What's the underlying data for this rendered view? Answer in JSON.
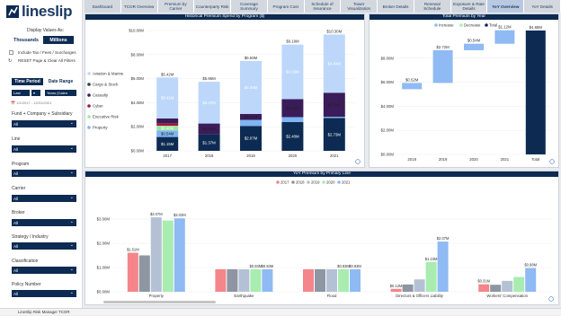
{
  "brand": {
    "name": "lineslip"
  },
  "sidebar": {
    "display_label": "Display Values As:",
    "thousands": "Thousands",
    "millions": "Millions",
    "include_tax": "Include Tax / Fees / Surcharges",
    "reset": "RESET Page & Clear All Filters",
    "time_period": "Time Period",
    "date_range": "Date Range",
    "period_value": "Last",
    "period_unit": "Years (Calen",
    "date_range_value": "1/1/2017 - 12/31/2021",
    "filters": [
      {
        "label": "Fund + Company + Subsidiary",
        "value": "All"
      },
      {
        "label": "Line",
        "value": "All"
      },
      {
        "label": "Program",
        "value": "All"
      },
      {
        "label": "Carrier",
        "value": "All"
      },
      {
        "label": "Broker",
        "value": "All"
      },
      {
        "label": "Strategy / Industry",
        "value": "All"
      },
      {
        "label": "Classification",
        "value": "All"
      },
      {
        "label": "Policy Number",
        "value": "All"
      }
    ],
    "accent": "#0d2b52"
  },
  "tabs": [
    "Dashboard",
    "TCOR Overview",
    "Premium by Carrier",
    "Counterparty Risk",
    "Coverage Summary",
    "Program Cost",
    "Schedule of Insurance",
    "Tower Visualization",
    "Broker Details",
    "Renewal Schedule",
    "Exposure & Rate Details",
    "YoY Overview",
    "YoY Details"
  ],
  "active_tab": "YoY Overview",
  "status_bar": "LineSlip Risk Manager TCOR",
  "chart_data": [
    {
      "type": "bar",
      "title": "Historical Premium Spend by Program ($)",
      "categories": [
        "2017",
        "2018",
        "2019",
        "2020",
        "2021"
      ],
      "ylim": [
        0,
        10
      ],
      "yticks": [
        "$0.00M",
        "$2.00M",
        "$4.00M",
        "$6.00M",
        "$8.00M",
        "$10.00M"
      ],
      "legend": [
        "Aviation & Marine",
        "Cargo & Stock",
        "Casualty",
        "Cyber",
        "Executive Risk",
        "Property"
      ],
      "colors": [
        "#bdd7fb",
        "#2d3e50",
        "#3a1c5a",
        "#a8123e",
        "#9ee6a0",
        "#7fb4f5",
        "#0d2b52"
      ],
      "totals": [
        "$5.42M",
        "$5.96M",
        "$6.59M",
        "$9.19M",
        "$10.30M"
      ],
      "series": [
        {
          "values": [
            1.15,
            1.37,
            2.07,
            2.4,
            2.73
          ],
          "labels": [
            "$1.15M",
            "$1.37M",
            "$2.07M",
            "$2.40M",
            "$2.73M"
          ]
        },
        {
          "values": [
            0.54,
            0.0,
            0.5,
            0.4,
            0.1
          ],
          "labels": [
            "$0.54M",
            "",
            "",
            "",
            ""
          ]
        },
        {
          "values": [
            0.4,
            0.0,
            0.0,
            0.0,
            0.0
          ],
          "labels": [
            "$0.40M",
            "",
            "",
            "",
            ""
          ]
        },
        {
          "values": [
            0.2,
            0.0,
            0.0,
            0.0,
            0.0
          ],
          "labels": [
            "",
            "",
            "",
            "",
            ""
          ]
        },
        {
          "values": [
            0.4,
            0.9,
            0.5,
            1.5,
            2.0
          ],
          "labels": [
            "",
            "$0.90M",
            "$0.50M",
            "$1.50M",
            "$2.00M"
          ]
        },
        {
          "values": [
            3.41,
            3.47,
            4.4,
            4.53,
            4.84
          ],
          "labels": [
            "$3.41M",
            "$3.47M",
            "$4.40M",
            "$4.53M",
            "$4.84M"
          ]
        }
      ]
    },
    {
      "type": "bar",
      "title": "Total Premium by Year",
      "legend": [
        "Increase",
        "Decrease",
        "Total"
      ],
      "colors": [
        "#8fbaf3",
        "#a8ecb0",
        "#0d2b52"
      ],
      "categories": [
        "2018",
        "2019",
        "2020",
        "2021",
        "Total"
      ],
      "ylim": [
        0,
        10
      ],
      "yticks": [
        "$0.00M",
        "$2.00M",
        "$4.00M",
        "$6.00M",
        "$8.00M"
      ],
      "values": [
        0.52,
        2.72,
        0.54,
        1.12,
        4.88
      ],
      "labels": [
        "$0.52M",
        "$2.72M",
        "$0.54M",
        "$1.12M",
        "$4.88M"
      ],
      "kind": [
        "increase",
        "increase",
        "increase",
        "increase",
        "total"
      ]
    },
    {
      "type": "bar",
      "title": "YoY Premium by Primary Line",
      "legend": [
        "2017",
        "2018",
        "2019",
        "2020",
        "2021"
      ],
      "colors": [
        "#f4858a",
        "#8d96a2",
        "#b4c1d5",
        "#a8ecb0",
        "#8fbaf3"
      ],
      "categories": [
        "Property",
        "Earthquake",
        "Flood",
        "Directors & Officers Liability",
        "Workers' Compensation"
      ],
      "ylim": [
        0,
        4
      ],
      "yticks": [
        "$0.00M",
        "$1.00M",
        "$2.00M",
        "$3.00M"
      ],
      "series": [
        {
          "name": "2017",
          "values": [
            1.61,
            0.93,
            0.93,
            0.12,
            0.31
          ],
          "labels": [
            "$1.61M",
            "",
            "",
            "$0.12M",
            "$0.31M"
          ]
        },
        {
          "name": "2018",
          "values": [
            1.5,
            0.93,
            0.93,
            0.3,
            0.29
          ],
          "labels": [
            "",
            "",
            "",
            "",
            ""
          ]
        },
        {
          "name": "2019",
          "values": [
            3.07,
            0.93,
            0.93,
            0.51,
            0.45
          ],
          "labels": [
            "$3.07M",
            "",
            "",
            "",
            ""
          ]
        },
        {
          "name": "2020",
          "values": [
            2.94,
            0.93,
            0.93,
            1.23,
            0.61
          ],
          "labels": [
            "",
            "$0.93M",
            "$0.93M",
            "$1.23M",
            ""
          ]
        },
        {
          "name": "2021",
          "values": [
            3.03,
            0.93,
            0.93,
            2.07,
            0.98
          ],
          "labels": [
            "$3.03M",
            "$0.93M",
            "$0.93M",
            "$2.07M",
            "$0.98M"
          ]
        }
      ]
    }
  ]
}
